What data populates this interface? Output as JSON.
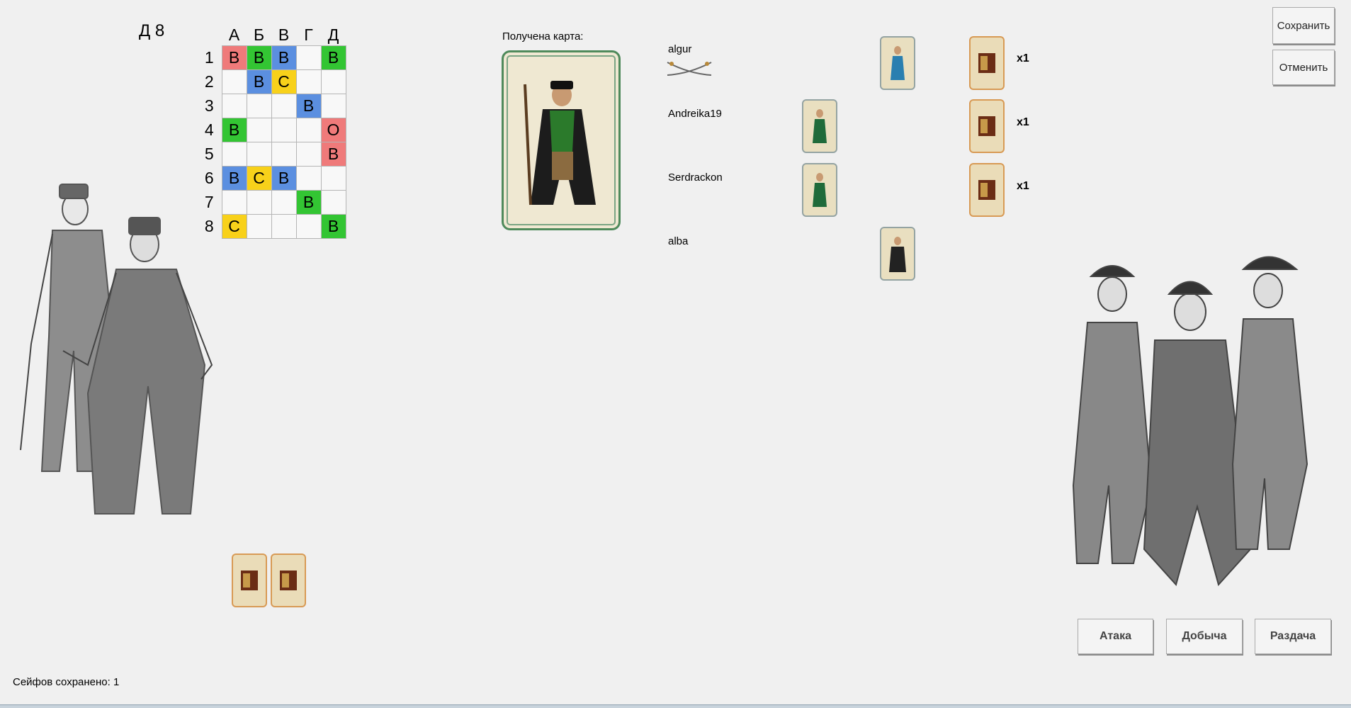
{
  "board": {
    "label": "Д 8",
    "columns": [
      "А",
      "Б",
      "В",
      "Г",
      "Д"
    ],
    "rows": [
      {
        "label": "1",
        "cells": [
          {
            "t": "В",
            "c": "red"
          },
          {
            "t": "В",
            "c": "green"
          },
          {
            "t": "В",
            "c": "blue"
          },
          {
            "t": "",
            "c": ""
          },
          {
            "t": "В",
            "c": "green"
          }
        ]
      },
      {
        "label": "2",
        "cells": [
          {
            "t": "",
            "c": ""
          },
          {
            "t": "В",
            "c": "blue"
          },
          {
            "t": "С",
            "c": "yellow"
          },
          {
            "t": "",
            "c": ""
          },
          {
            "t": "",
            "c": ""
          }
        ]
      },
      {
        "label": "3",
        "cells": [
          {
            "t": "",
            "c": ""
          },
          {
            "t": "",
            "c": ""
          },
          {
            "t": "",
            "c": ""
          },
          {
            "t": "В",
            "c": "blue"
          },
          {
            "t": "",
            "c": ""
          }
        ]
      },
      {
        "label": "4",
        "cells": [
          {
            "t": "В",
            "c": "green"
          },
          {
            "t": "",
            "c": ""
          },
          {
            "t": "",
            "c": ""
          },
          {
            "t": "",
            "c": ""
          },
          {
            "t": "О",
            "c": "red"
          }
        ]
      },
      {
        "label": "5",
        "cells": [
          {
            "t": "",
            "c": ""
          },
          {
            "t": "",
            "c": ""
          },
          {
            "t": "",
            "c": ""
          },
          {
            "t": "",
            "c": ""
          },
          {
            "t": "В",
            "c": "red"
          }
        ]
      },
      {
        "label": "6",
        "cells": [
          {
            "t": "В",
            "c": "blue"
          },
          {
            "t": "С",
            "c": "yellow"
          },
          {
            "t": "В",
            "c": "blue"
          },
          {
            "t": "",
            "c": ""
          },
          {
            "t": "",
            "c": ""
          }
        ]
      },
      {
        "label": "7",
        "cells": [
          {
            "t": "",
            "c": ""
          },
          {
            "t": "",
            "c": ""
          },
          {
            "t": "",
            "c": ""
          },
          {
            "t": "В",
            "c": "green"
          },
          {
            "t": "",
            "c": ""
          }
        ]
      },
      {
        "label": "8",
        "cells": [
          {
            "t": "С",
            "c": "yellow"
          },
          {
            "t": "",
            "c": ""
          },
          {
            "t": "",
            "c": ""
          },
          {
            "t": "",
            "c": ""
          },
          {
            "t": "В",
            "c": "green"
          }
        ]
      }
    ]
  },
  "received": {
    "label": "Получена карта:",
    "card_icon": "pirate-captain-card"
  },
  "players": [
    {
      "name": "algur",
      "icon": "crossed-swords-icon",
      "count": "x1"
    },
    {
      "name": "Andreika19",
      "count": "x1"
    },
    {
      "name": "Serdrackon",
      "count": "x1"
    },
    {
      "name": "alba"
    }
  ],
  "buttons": {
    "save": "Сохранить",
    "cancel": "Отменить",
    "attack": "Атака",
    "loot": "Добыча",
    "deal": "Раздача"
  },
  "status": "Сейфов сохранено: 1",
  "colors": {
    "red": "#ef7a7a",
    "green": "#33c533",
    "blue": "#5b8fe0",
    "yellow": "#f8d11a"
  }
}
